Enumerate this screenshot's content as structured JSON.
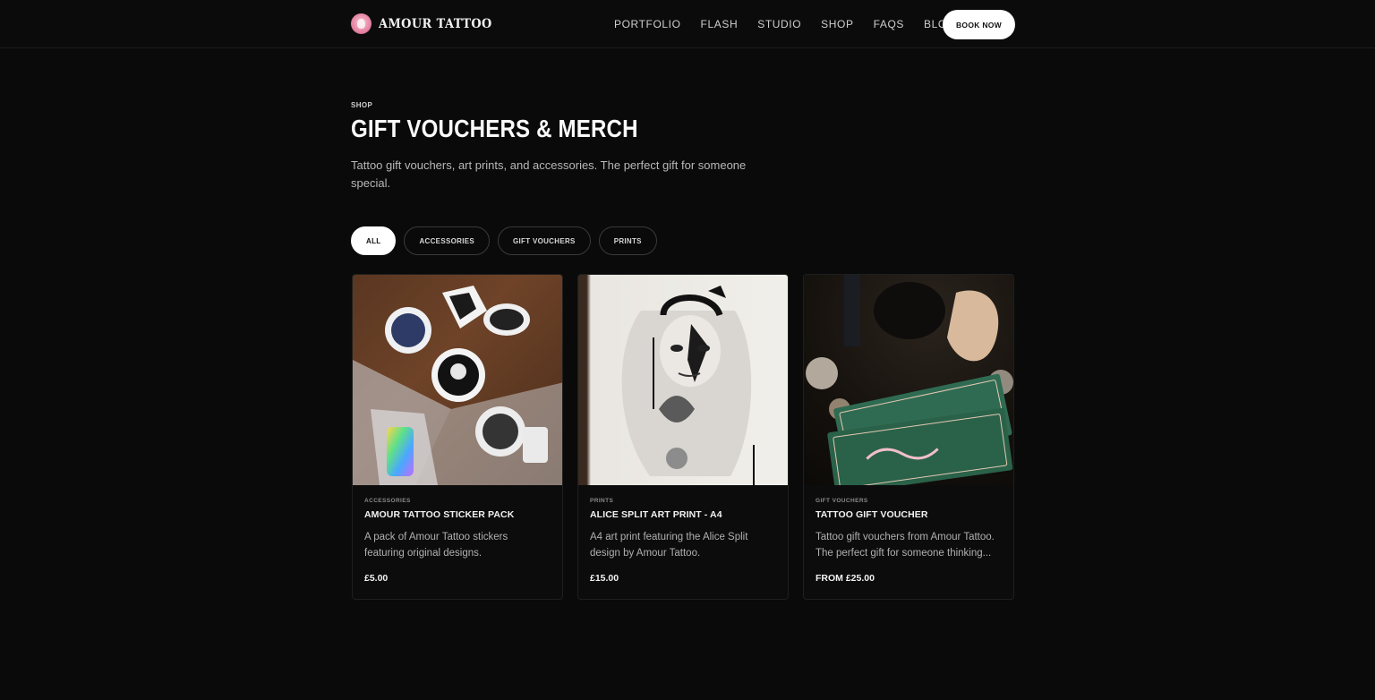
{
  "header": {
    "brand": "AMOUR TATTOO",
    "nav": [
      "PORTFOLIO",
      "FLASH",
      "STUDIO",
      "SHOP",
      "FAQS",
      "BLOG"
    ],
    "cta": "BOOK NOW"
  },
  "hero": {
    "eyebrow": "SHOP",
    "title": "GIFT VOUCHERS & MERCH",
    "description": "Tattoo gift vouchers, art prints, and accessories. The perfect gift for someone special."
  },
  "filters": {
    "items": [
      "ALL",
      "ACCESSORIES",
      "GIFT VOUCHERS",
      "PRINTS"
    ],
    "active": "ALL"
  },
  "products": [
    {
      "category": "ACCESSORIES",
      "name": "AMOUR TATTOO STICKER PACK",
      "description": "A pack of Amour Tattoo stickers featuring original designs.",
      "price": "£5.00"
    },
    {
      "category": "PRINTS",
      "name": "ALICE SPLIT ART PRINT - A4",
      "description": "A4 art print featuring the Alice Split design by Amour Tattoo.",
      "price": "£15.00"
    },
    {
      "category": "GIFT VOUCHERS",
      "name": "TATTOO GIFT VOUCHER",
      "description": "Tattoo gift vouchers from Amour Tattoo. The perfect gift for someone thinking...",
      "price": "FROM £25.00"
    }
  ],
  "colors": {
    "background": "#0a0a0a",
    "accent_pink": "#e889a7",
    "voucher_green": "#2f6b52"
  }
}
